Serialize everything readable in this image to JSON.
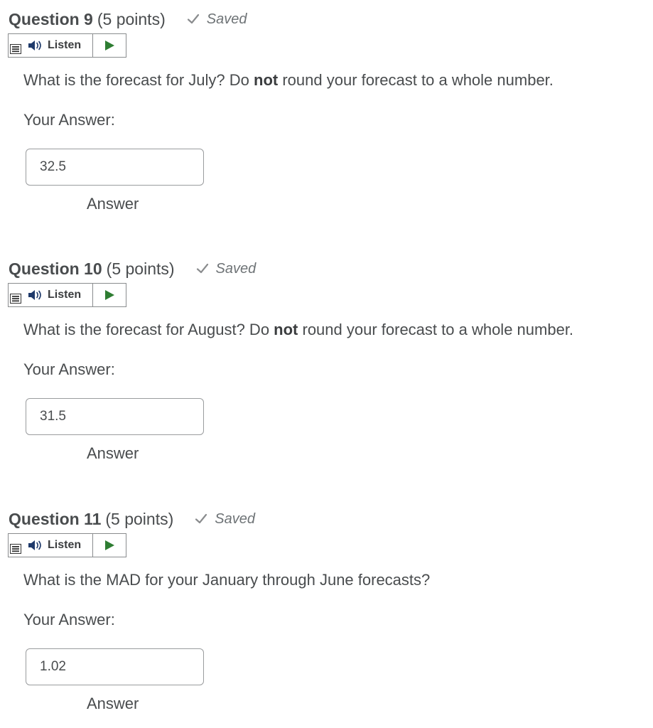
{
  "questions": [
    {
      "title": "Question 9",
      "points": "(5 points)",
      "saved_label": "Saved",
      "listen_label": "Listen",
      "text_before": "What is the forecast for July? Do ",
      "text_bold": "not",
      "text_after": " round your forecast to a whole number.",
      "your_answer_label": "Your Answer:",
      "answer_value": "32.5",
      "answer_label": "Answer"
    },
    {
      "title": "Question 10",
      "points": "(5 points)",
      "saved_label": "Saved",
      "listen_label": "Listen",
      "text_before": "What is the forecast for August? Do ",
      "text_bold": "not",
      "text_after": " round your forecast to a whole number.",
      "your_answer_label": "Your Answer:",
      "answer_value": "31.5",
      "answer_label": "Answer"
    },
    {
      "title": "Question 11",
      "points": "(5 points)",
      "saved_label": "Saved",
      "listen_label": "Listen",
      "text_before": "What is the MAD for your January through June forecasts?",
      "text_bold": "",
      "text_after": "",
      "your_answer_label": "Your Answer:",
      "answer_value": "1.02",
      "answer_label": "Answer"
    }
  ],
  "icons": {
    "saved": "check-icon",
    "listen": "speaker-icon",
    "menu": "menu-icon",
    "play": "play-icon"
  },
  "colors": {
    "play": "#2e7d32",
    "speaker": "#1f3a6b",
    "text": "#494c4e",
    "saved": "#6e7376"
  }
}
